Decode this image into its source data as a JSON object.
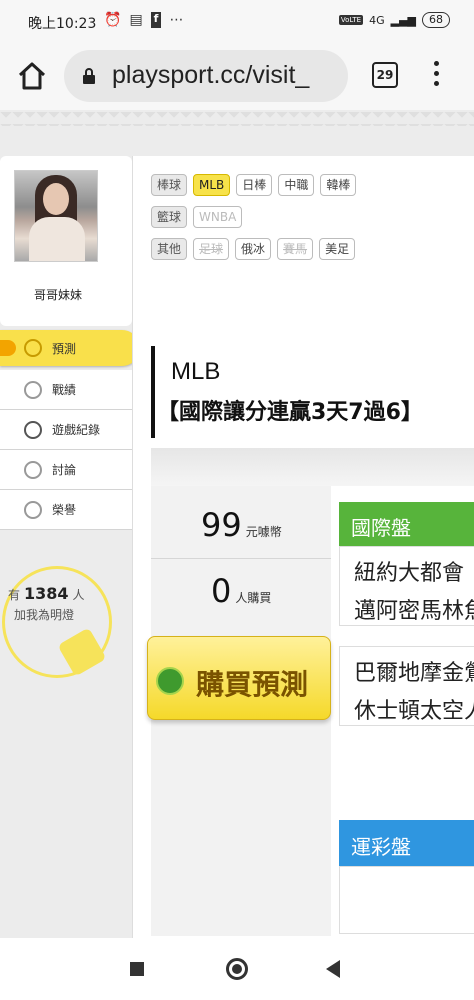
{
  "status": {
    "time": "晚上10:23",
    "icons": [
      "alarm-icon",
      "message-icon",
      "facebook-icon",
      "more-icon"
    ],
    "network": "4G",
    "battery": "68"
  },
  "browser": {
    "url": "playsport.cc/visit_",
    "tab_count": "29"
  },
  "profile": {
    "username": "哥哥妹妹"
  },
  "nav": {
    "items": [
      {
        "label": "預測",
        "icon": "target-icon",
        "active": true
      },
      {
        "label": "戰績",
        "icon": "trophy-icon",
        "active": false
      },
      {
        "label": "遊戲紀錄",
        "icon": "circle-icon",
        "active": false
      },
      {
        "label": "討論",
        "icon": "chat-icon",
        "active": false
      },
      {
        "label": "榮譽",
        "icon": "medal-icon",
        "active": false
      }
    ]
  },
  "fans": {
    "prefix": "有",
    "count": "1384",
    "suffix": "人",
    "line2": "加我為明燈"
  },
  "categories": {
    "row1": {
      "label": "棒球",
      "tags": [
        "MLB",
        "日棒",
        "中職",
        "韓棒"
      ]
    },
    "row2": {
      "label": "籃球",
      "tags": [
        "WNBA"
      ]
    },
    "row3": {
      "label": "其他",
      "tags": [
        "足球",
        "俄冰",
        "賽馬",
        "美足"
      ]
    }
  },
  "prediction": {
    "league": "MLB",
    "title": "【國際讓分連贏3天7過6】",
    "price": "99",
    "price_unit": "元噱幣",
    "buyers": "0",
    "buyers_unit": "人購買",
    "buy_button": "購買預測"
  },
  "intl": {
    "header": "國際盤",
    "games": [
      {
        "team1": "紐約大都會",
        "team2": "邁阿密馬林魚"
      },
      {
        "team1": "巴爾地摩金鶯",
        "team2": "休士頓太空人"
      }
    ]
  },
  "lottery": {
    "header": "運彩盤"
  },
  "colors": {
    "accent_yellow": "#f7e24a",
    "intl_green": "#57b43b",
    "lottery_blue": "#2f96e0"
  }
}
